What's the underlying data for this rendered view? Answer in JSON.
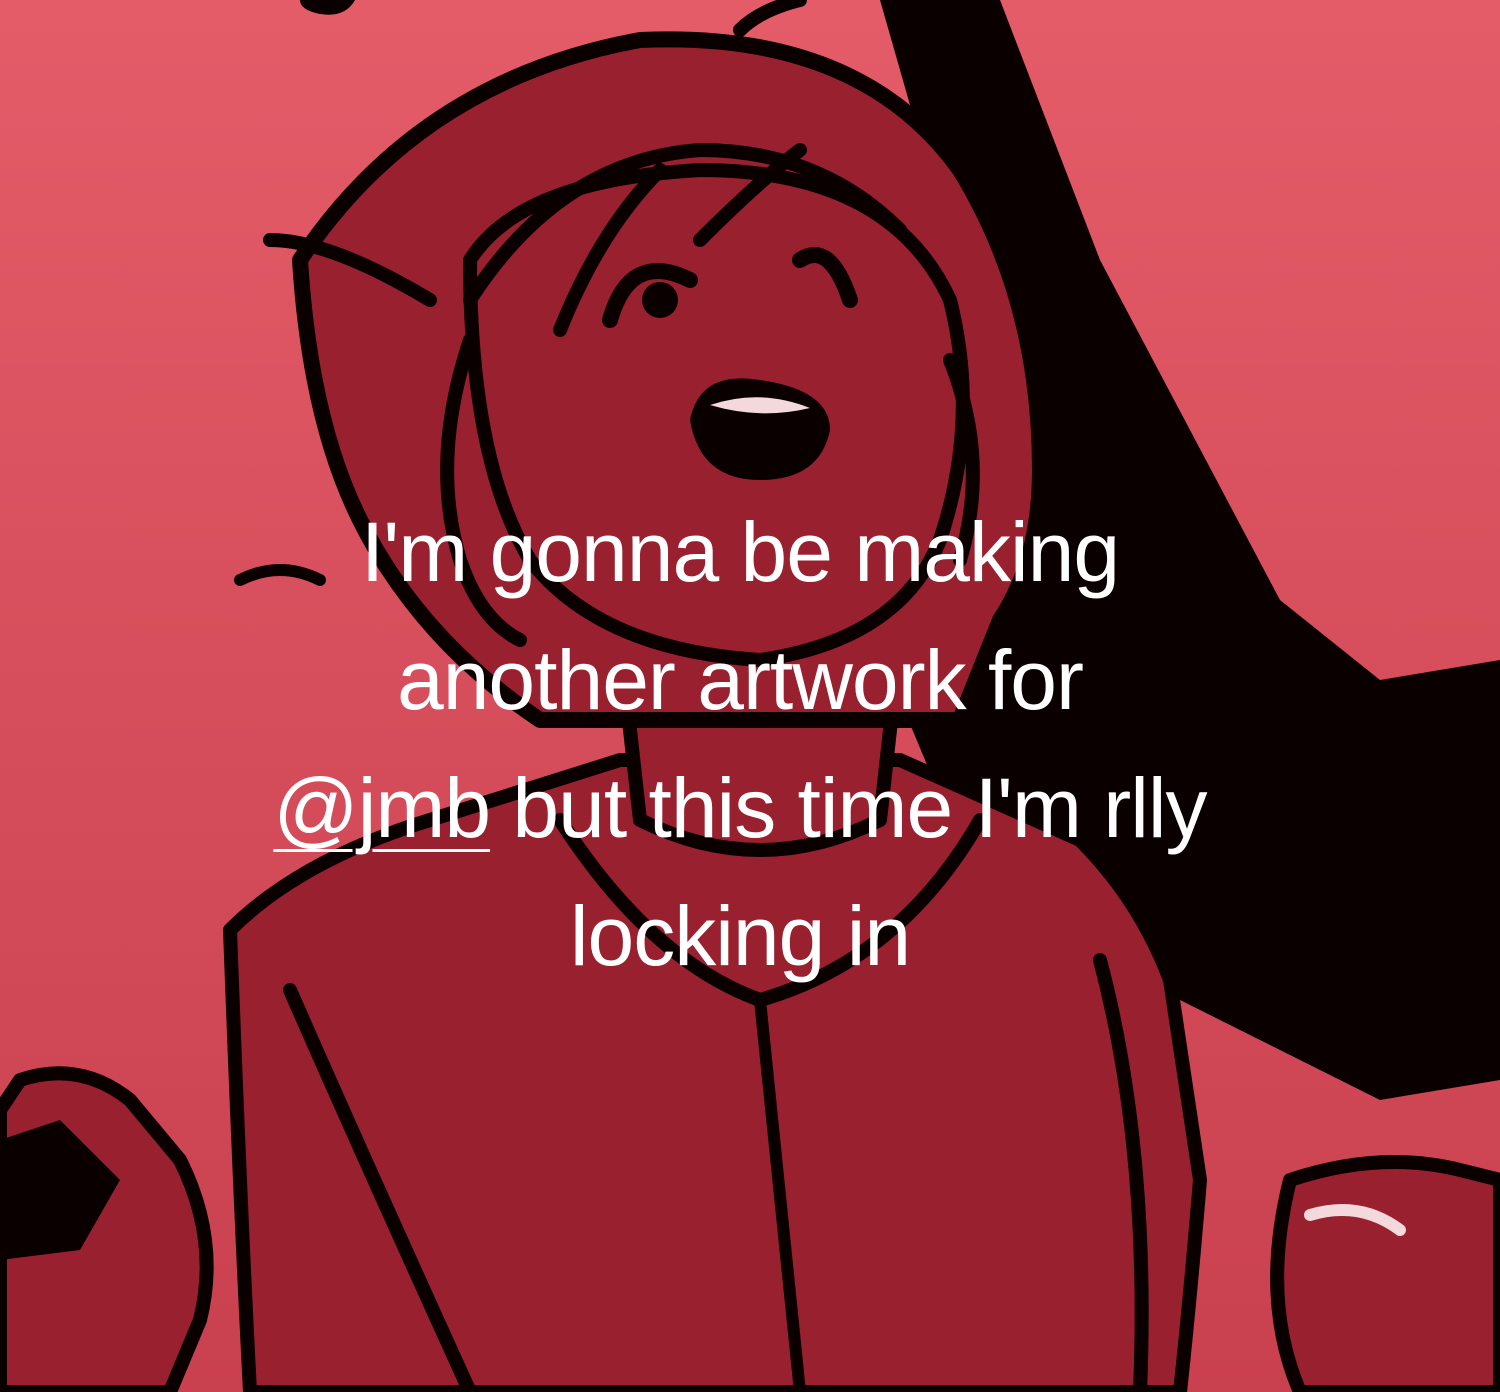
{
  "background": {
    "gradient_top": "#e25966",
    "gradient_bottom": "#cc4553",
    "figure_fill": "#98202f",
    "outline_color": "#0a0000"
  },
  "caption": {
    "line1": "I'm gonna be making",
    "line2": "another artwork for",
    "mention": "@jmb",
    "line3_rest": " but this time I'm rlly",
    "line4": "locking in",
    "text_color": "#ffffff"
  }
}
